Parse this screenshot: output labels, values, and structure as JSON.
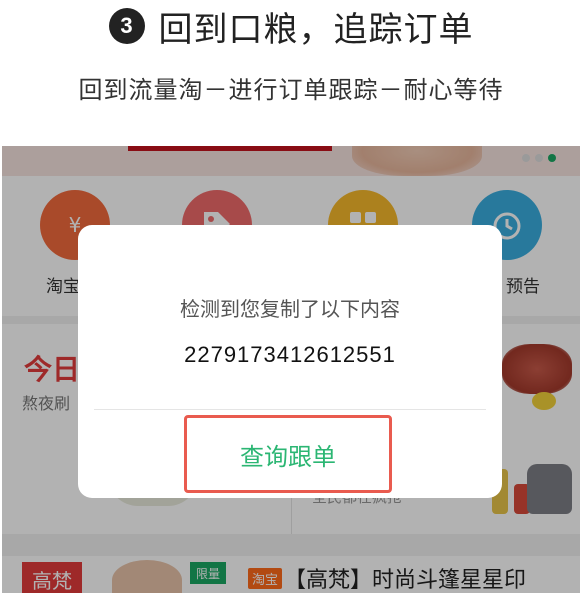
{
  "heading": {
    "step_number": "3",
    "title": "回到口粮，追踪订单"
  },
  "subheading": "回到流量淘－进行订单跟踪－耐心等待",
  "app": {
    "nav": [
      {
        "label": "淘宝",
        "icon": "yen-bag-icon",
        "color": "#f26a3d"
      },
      {
        "label": "",
        "icon": "tag-icon",
        "color": "#f06b6b"
      },
      {
        "label": "",
        "icon": "grid-icon",
        "color": "#f6b92b"
      },
      {
        "label": "预告",
        "icon": "alarm-clock-icon",
        "color": "#3aaee0"
      }
    ],
    "promo": {
      "title": "今日",
      "subtitle": "熬夜刷",
      "right_text": "全民都在疯抢"
    },
    "list_item": {
      "brand_badge": "高梵",
      "limit_tag": "限量",
      "source_tag": "淘宝",
      "title": "【高梵】时尚斗篷星星印"
    }
  },
  "dialog": {
    "message": "检测到您复制了以下内容",
    "code": "2279173412612551",
    "button_label": "查询跟单"
  },
  "colors": {
    "accent_green": "#2bb673",
    "highlight_red": "#e95b4f",
    "brand_red": "#e23b3b"
  }
}
